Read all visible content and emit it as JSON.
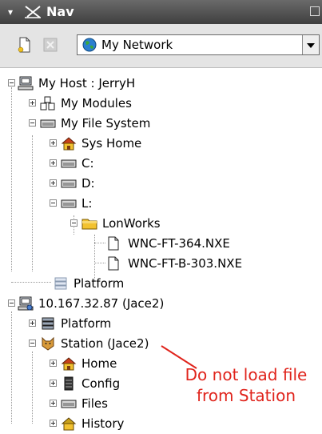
{
  "titlebar": {
    "title": "Nav",
    "menu_glyph": "▾"
  },
  "toolbar": {
    "combo_value": "My Network"
  },
  "tree": {
    "my_host": "My Host : JerryH",
    "my_modules": "My Modules",
    "my_file_system": "My File System",
    "sys_home": "Sys Home",
    "c_drive": "C:",
    "d_drive": "D:",
    "l_drive": "L:",
    "lonworks": "LonWorks",
    "file1": "WNC-FT-364.NXE",
    "file2": "WNC-FT-B-303.NXE",
    "platform_local": "Platform",
    "remote_host": "10.167.32.87 (Jace2)",
    "platform_remote": "Platform",
    "station": "Station (Jace2)",
    "home": "Home",
    "config": "Config",
    "files": "Files",
    "history": "History"
  },
  "annotation": {
    "line1": "Do not load file",
    "line2": "from Station"
  },
  "colors": {
    "annotation": "#e0241c",
    "folder": "#f2c230",
    "station_icon": "#d89a3a"
  }
}
